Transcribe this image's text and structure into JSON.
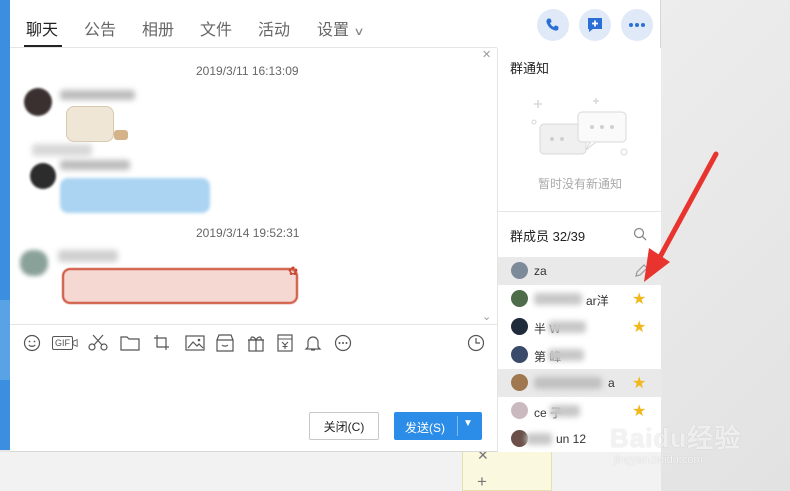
{
  "tabs": [
    {
      "label": "聊天",
      "active": true
    },
    {
      "label": "公告",
      "active": false
    },
    {
      "label": "相册",
      "active": false
    },
    {
      "label": "文件",
      "active": false
    },
    {
      "label": "活动",
      "active": false
    },
    {
      "label": "设置",
      "active": false
    }
  ],
  "header_actions": [
    "phone-icon",
    "add-message-icon",
    "more-icon"
  ],
  "chat": {
    "timestamps": [
      "2019/3/11 16:13:09",
      "2019/3/14 19:52:31"
    ]
  },
  "toolbar_icons": [
    "emoji-icon",
    "gif-icon",
    "scissors-icon",
    "folder-icon",
    "screenshot-icon",
    "image-icon",
    "shop-icon",
    "gift-icon",
    "red-packet-icon",
    "bell-icon",
    "more-circle-icon",
    "history-clock-icon"
  ],
  "toolbar": {
    "gif_label": "GIF"
  },
  "buttons": {
    "close": "关闭(C)",
    "send": "发送(S)"
  },
  "right_panel": {
    "notice_title": "群通知",
    "notice_empty": "暂时没有新通知",
    "members_title": "群成员 32/39",
    "members": [
      {
        "name": "za",
        "action": "edit-icon",
        "selected": true
      },
      {
        "name": "ar洋",
        "star": true
      },
      {
        "name": "半  W",
        "star": true
      },
      {
        "name": "第  峰",
        "star": false
      },
      {
        "name": "  a",
        "star": true
      },
      {
        "name": "ce   子",
        "star": true
      },
      {
        "name": "un  12",
        "star": false
      }
    ]
  },
  "watermark": {
    "brand": "Baidu经验",
    "url": "jingyan.baidu.com"
  },
  "colors": {
    "accent": "#2b8de8",
    "annotation_arrow": "#e8332e",
    "star": "#f1b71b"
  }
}
